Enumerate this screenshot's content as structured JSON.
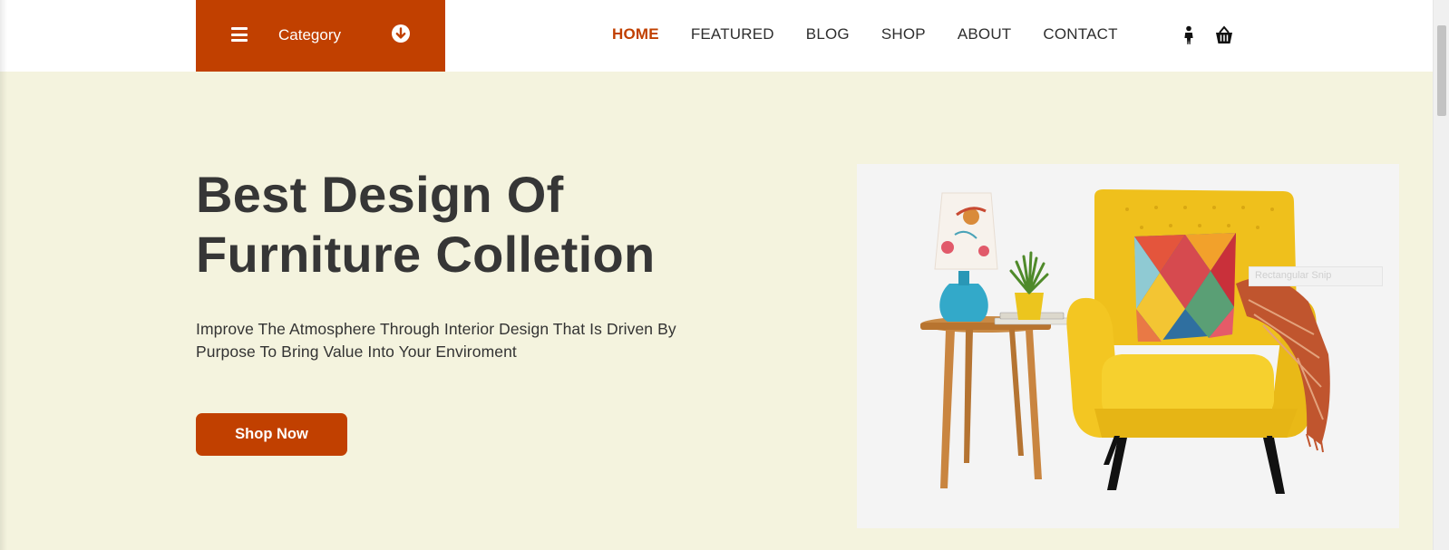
{
  "header": {
    "category_label": "Category",
    "nav": [
      {
        "label": "HOME",
        "active": true
      },
      {
        "label": "FEATURED",
        "active": false
      },
      {
        "label": "BLOG",
        "active": false
      },
      {
        "label": "SHOP",
        "active": false
      },
      {
        "label": "ABOUT",
        "active": false
      },
      {
        "label": "CONTACT",
        "active": false
      }
    ],
    "icons": [
      "menu-icon",
      "arrow-down-circle-icon",
      "user-icon",
      "cart-icon"
    ]
  },
  "hero": {
    "title_line1": "Best Design Of",
    "title_line2": "Furniture Colletion",
    "subtitle_line1": "Improve The Atmosphere Through Interior Design That Is Driven By",
    "subtitle_line2": "Purpose To Bring Value Into Your Enviroment",
    "cta_label": "Shop Now",
    "overlay_text": "Rectangular Snip"
  },
  "colors": {
    "accent": "#c14000",
    "hero_background": "#f4f3de",
    "image_background": "#f4f4f4",
    "heading_text": "#363636",
    "chair_yellow": "#f0c020"
  }
}
